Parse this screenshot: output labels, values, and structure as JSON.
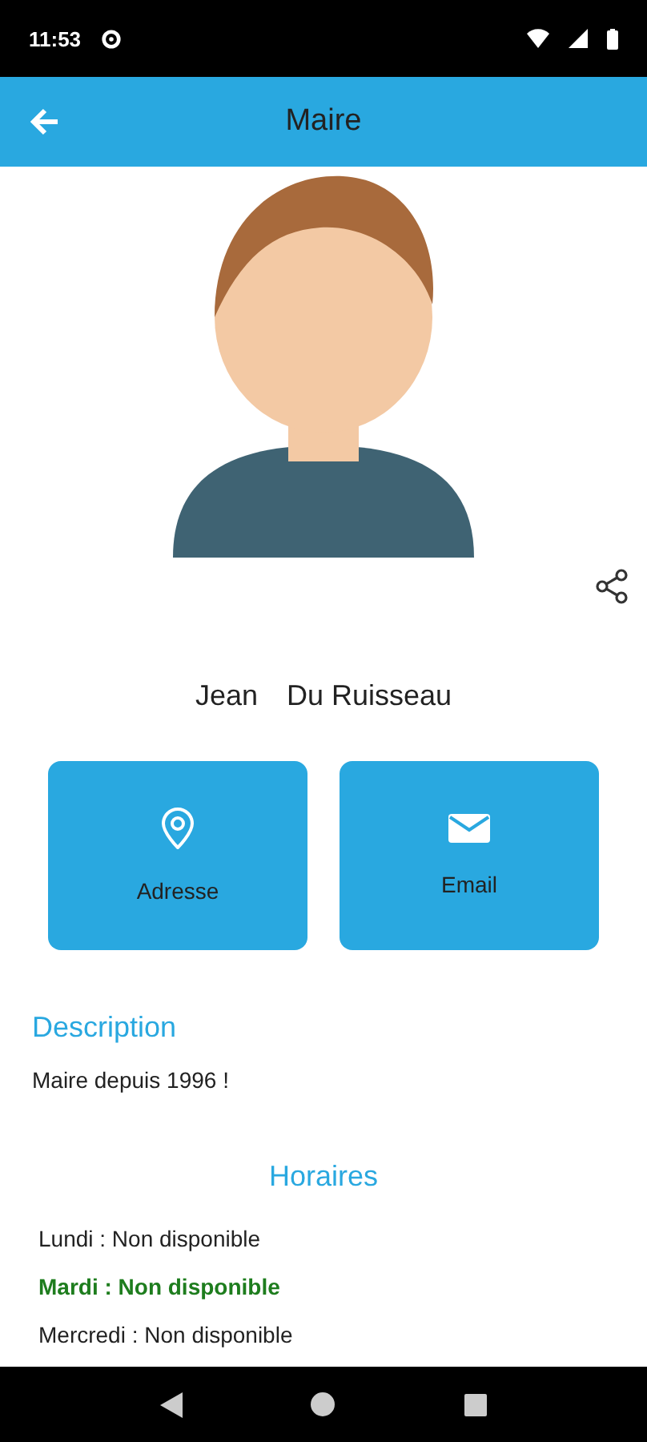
{
  "status_bar": {
    "time": "11:53"
  },
  "app_bar": {
    "title": "Maire"
  },
  "profile": {
    "first_name": "Jean",
    "last_name": "Du Ruisseau"
  },
  "actions": [
    {
      "kind": "address",
      "label": "Adresse"
    },
    {
      "kind": "email",
      "label": "Email"
    }
  ],
  "description": {
    "heading": "Description",
    "text": "Maire depuis 1996 !"
  },
  "hours": {
    "heading": "Horaires",
    "days": [
      {
        "text": "Lundi : Non disponible",
        "current": false
      },
      {
        "text": "Mardi : Non disponible",
        "current": true
      },
      {
        "text": "Mercredi : Non disponible",
        "current": false
      }
    ]
  }
}
